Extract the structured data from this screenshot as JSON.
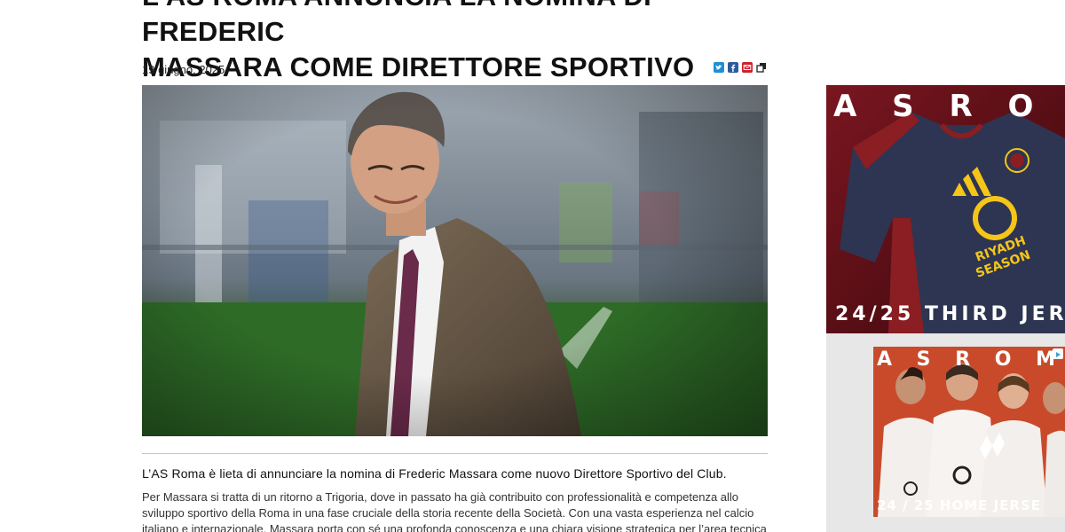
{
  "article": {
    "title_line1": "L'AS ROMA ANNUNCIA LA NOMINA DI FREDERIC",
    "title_line2": "MASSARA COME DIRETTORE SPORTIVO",
    "date": "19 giugno, 2025",
    "lead": "L’AS Roma è lieta di annunciare la nomina di Frederic Massara come nuovo Direttore Sportivo del Club.",
    "body_lines": [
      "Per Massara si tratta di un ritorno a Trigoria, dove in passato ha già contribuito con professionalità e competenza allo",
      "sviluppo sportivo della Roma in una fase cruciale della storia recente della Società. Con una vasta esperienza nel calcio",
      "italiano e internazionale, Massara porta con sé una profonda conoscenza e una chiara visione strategica per l’area tecnica"
    ]
  },
  "share": {
    "icons": [
      "twitter-icon",
      "facebook-icon",
      "email-icon",
      "copy-link-icon"
    ],
    "colors": {
      "twitter": "#1d8fd6",
      "facebook": "#2f5b9a",
      "email": "#d11f2a",
      "copy": "#222222"
    }
  },
  "ads": {
    "ad1": {
      "header": "A S   R O M",
      "footer": "24/25 THIRD JER",
      "sponsor_line1": "RIYADH",
      "sponsor_line2": "SEASON"
    },
    "ad2": {
      "header": "A S   R O M A",
      "footer": "24 / 25 HOME JERSE"
    }
  },
  "colors": {
    "divider": "#f2b88f",
    "ad1_bg": "#5a0d16",
    "ad2_bg": "#c94a2b",
    "sponsor_yellow": "#f5c518"
  }
}
